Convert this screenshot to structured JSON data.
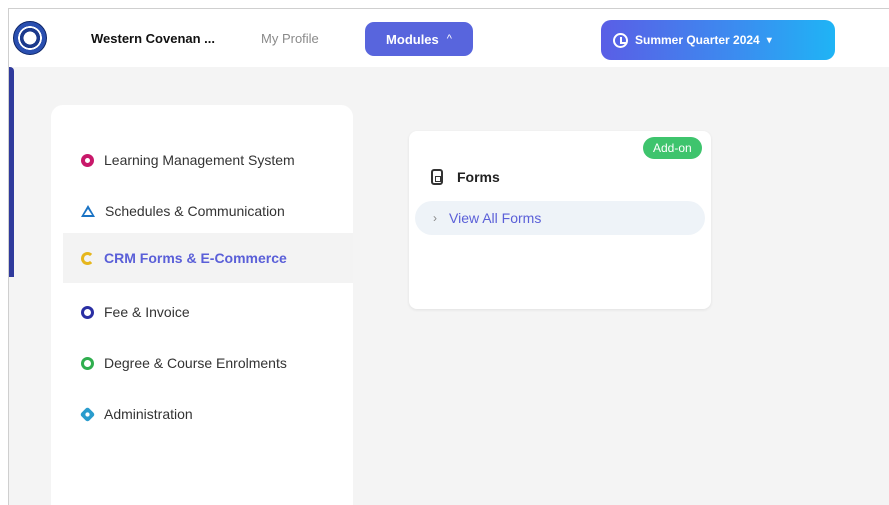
{
  "header": {
    "school_name": "Western Covenan ...",
    "my_profile": "My Profile",
    "modules_label": "Modules",
    "modules_caret": "^",
    "quarter_label": "Summer Quarter 2024",
    "quarter_caret": "▾",
    "logo_icon": "institution-seal-icon"
  },
  "modules_menu": {
    "items": [
      {
        "label": "Learning Management System",
        "icon": "lms-icon",
        "color": "#c8186a"
      },
      {
        "label": "Schedules & Communication",
        "icon": "triangle-icon",
        "color": "#1a73c4"
      },
      {
        "label": "CRM Forms & E-Commerce",
        "icon": "crm-icon",
        "color": "#e6b61c",
        "active": true
      },
      {
        "label": "Fee & Invoice",
        "icon": "circle-icon",
        "color": "#2a2fa3"
      },
      {
        "label": "Degree & Course Enrolments",
        "icon": "circle-icon",
        "color": "#2fae4e"
      },
      {
        "label": "Administration",
        "icon": "gear-icon",
        "color": "#2a9ccd"
      }
    ]
  },
  "submenu": {
    "badge": "Add-on",
    "title": "Forms",
    "link": "View All Forms",
    "chevron": "›"
  },
  "colors": {
    "accent": "#5865dd",
    "active_text": "#5a5fd8",
    "badge": "#3ec46d"
  }
}
